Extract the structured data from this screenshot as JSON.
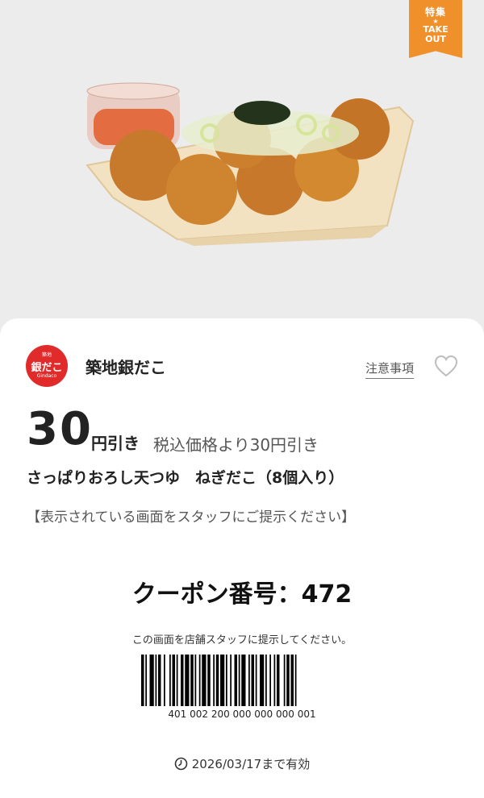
{
  "badge": {
    "top": "特集",
    "star": "★",
    "line1": "TAKE",
    "line2": "OUT"
  },
  "shop": {
    "name": "築地銀だこ",
    "logo_top": "築地",
    "logo_text": "銀だこ",
    "logo_sub": "Gindaco"
  },
  "notice_label": "注意事項",
  "discount": {
    "amount": "30",
    "unit": "円引き",
    "description": "税込価格より30円引き"
  },
  "product_name": "さっぱりおろし天つゆ　ねぎだこ（8個入り）",
  "present_note": "【表示されている画面をスタッフにご提示ください】",
  "coupon": {
    "label": "クーポン番号：472"
  },
  "show_staff_note": "この画面を店舗スタッフに提示してください。",
  "barcode_number": "401 002 200 000 000 000 001",
  "expiry": "2026/03/17まで有効",
  "colors": {
    "badge": "#f0902a",
    "logo": "#e12b2b",
    "hero_bg": "#ececec"
  },
  "icons": {
    "favorite": "heart-outline-icon",
    "expiry": "clock-icon"
  }
}
